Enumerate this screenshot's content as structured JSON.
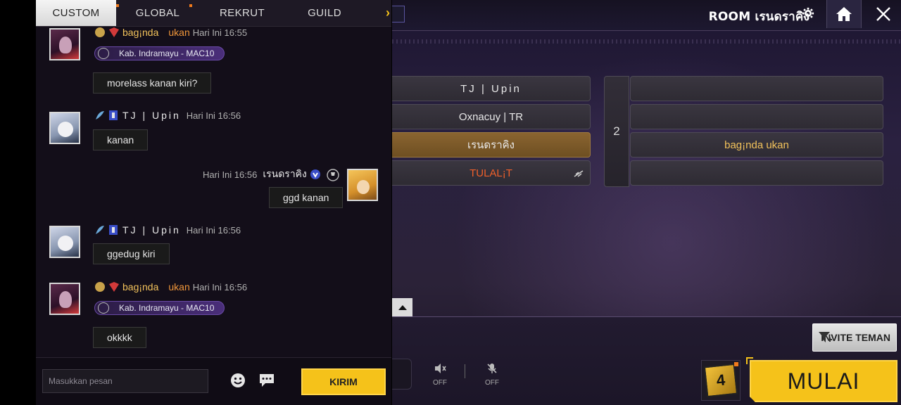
{
  "tabs": [
    {
      "label": "CUSTOM"
    },
    {
      "label": "GLOBAL"
    },
    {
      "label": "REKRUT"
    },
    {
      "label": "GUILD"
    }
  ],
  "messages": [
    {
      "sender": "bag¡nda",
      "suffix": "ukan",
      "time": "Hari Ini 16:55",
      "guild": "Kab. Indramayu - MAC10",
      "text": "morelass kanan kiri?"
    },
    {
      "sender": "TJ | Upin",
      "time": "Hari Ini 16:56",
      "text": "kanan"
    },
    {
      "sender": "เรนดราคิง",
      "time": "Hari Ini 16:56",
      "text": "ggd kanan"
    },
    {
      "sender": "TJ | Upin",
      "time": "Hari Ini 16:56",
      "text": "ggedug kiri"
    },
    {
      "sender": "bag¡nda",
      "suffix": "ukan",
      "time": "Hari Ini 16:56",
      "guild": "Kab. Indramayu - MAC10",
      "text": "okkkk"
    }
  ],
  "input": {
    "placeholder": "Masukkan pesan",
    "send_label": "KIRIM"
  },
  "room": {
    "title": "ROOM เรนดราคิง"
  },
  "team1": [
    "TJ | Upin",
    "Oxnacuy | TR",
    "เรนดราคิง",
    "TULAL¡T"
  ],
  "team2": {
    "number": "2",
    "slots": [
      "",
      "",
      "bag¡nda ukan",
      ""
    ]
  },
  "bottom": {
    "invite_label": "INVITE TEMAN",
    "start_label": "MULAI",
    "speaker_status": "OFF",
    "mic_status": "OFF",
    "dice_value": "4"
  }
}
